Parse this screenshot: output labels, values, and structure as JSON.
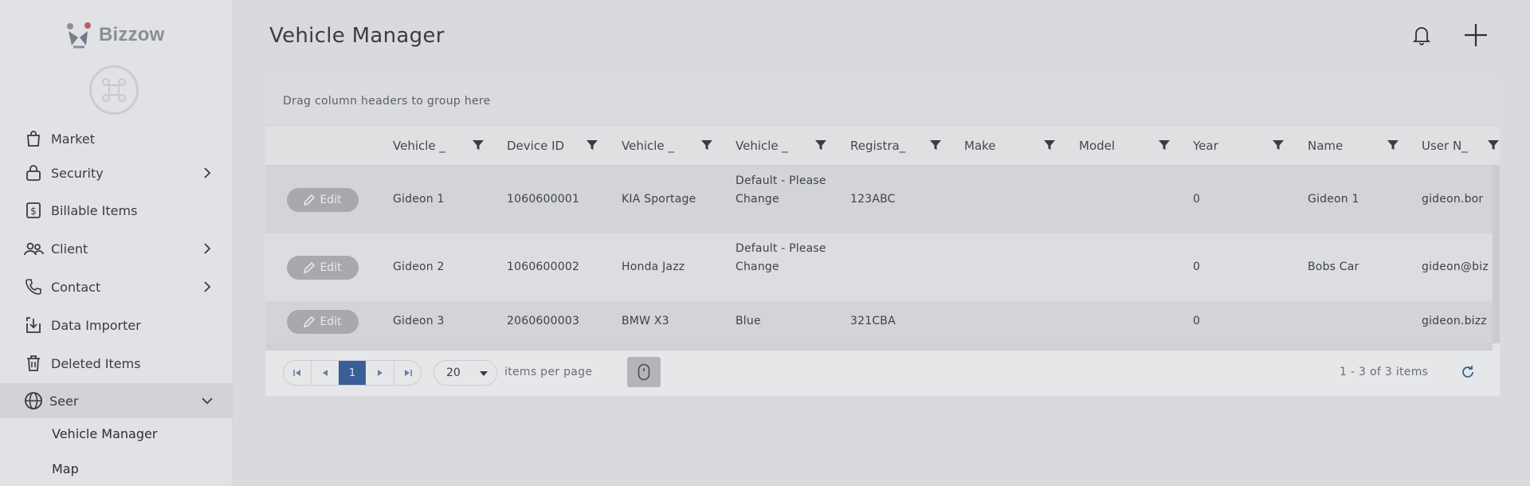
{
  "brand": {
    "name": "Bizzow"
  },
  "sidebar": {
    "items": [
      {
        "label": "Market",
        "icon": "shopping-bag-icon",
        "expandable": false
      },
      {
        "label": "Security",
        "icon": "lock-icon",
        "expandable": true
      },
      {
        "label": "Billable Items",
        "icon": "dollar-receipt-icon",
        "expandable": false
      },
      {
        "label": "Client",
        "icon": "users-icon",
        "expandable": true
      },
      {
        "label": "Contact",
        "icon": "phone-icon",
        "expandable": true
      },
      {
        "label": "Data Importer",
        "icon": "download-icon",
        "expandable": false
      },
      {
        "label": "Deleted Items",
        "icon": "trash-icon",
        "expandable": false
      },
      {
        "label": "Seer",
        "icon": "globe-icon",
        "expandable": true,
        "expanded": true
      }
    ],
    "sub_items": [
      {
        "label": "Vehicle Manager"
      },
      {
        "label": "Map"
      }
    ]
  },
  "header": {
    "title": "Vehicle Manager",
    "bell_icon": "bell-icon",
    "add_icon": "plus-icon"
  },
  "grid": {
    "group_hint": "Drag column headers to group here",
    "columns": [
      "Vehicle _",
      "Device ID",
      "Vehicle _",
      "Vehicle _",
      "Registra_",
      "Make",
      "Model",
      "Year",
      "Name",
      "User N_"
    ],
    "edit_label": "Edit",
    "rows": [
      {
        "c0": "Gideon 1",
        "c1": "1060600001",
        "c2": "KIA Sportage",
        "c3": "Default - Please Change",
        "c4": "123ABC",
        "c5": "",
        "c6": "",
        "c7": "0",
        "c8": "Gideon 1",
        "c9": "gideon.bor"
      },
      {
        "c0": "Gideon 2",
        "c1": "1060600002",
        "c2": "Honda Jazz",
        "c3": "Default - Please Change",
        "c4": "",
        "c5": "",
        "c6": "",
        "c7": "0",
        "c8": "Bobs Car",
        "c9": "gideon@biz"
      },
      {
        "c0": "Gideon 3",
        "c1": "2060600003",
        "c2": "BMW X3",
        "c3": "Blue",
        "c4": "321CBA",
        "c5": "",
        "c6": "",
        "c7": "0",
        "c8": "",
        "c9": "gideon.bizz"
      }
    ]
  },
  "pager": {
    "current_page": "1",
    "page_size": "20",
    "items_per_page_label": "items per page",
    "range_label": "1 - 3 of 3 items"
  },
  "colors": {
    "accent": "#3a5f98",
    "overlay_bg": "#d9dadd"
  }
}
